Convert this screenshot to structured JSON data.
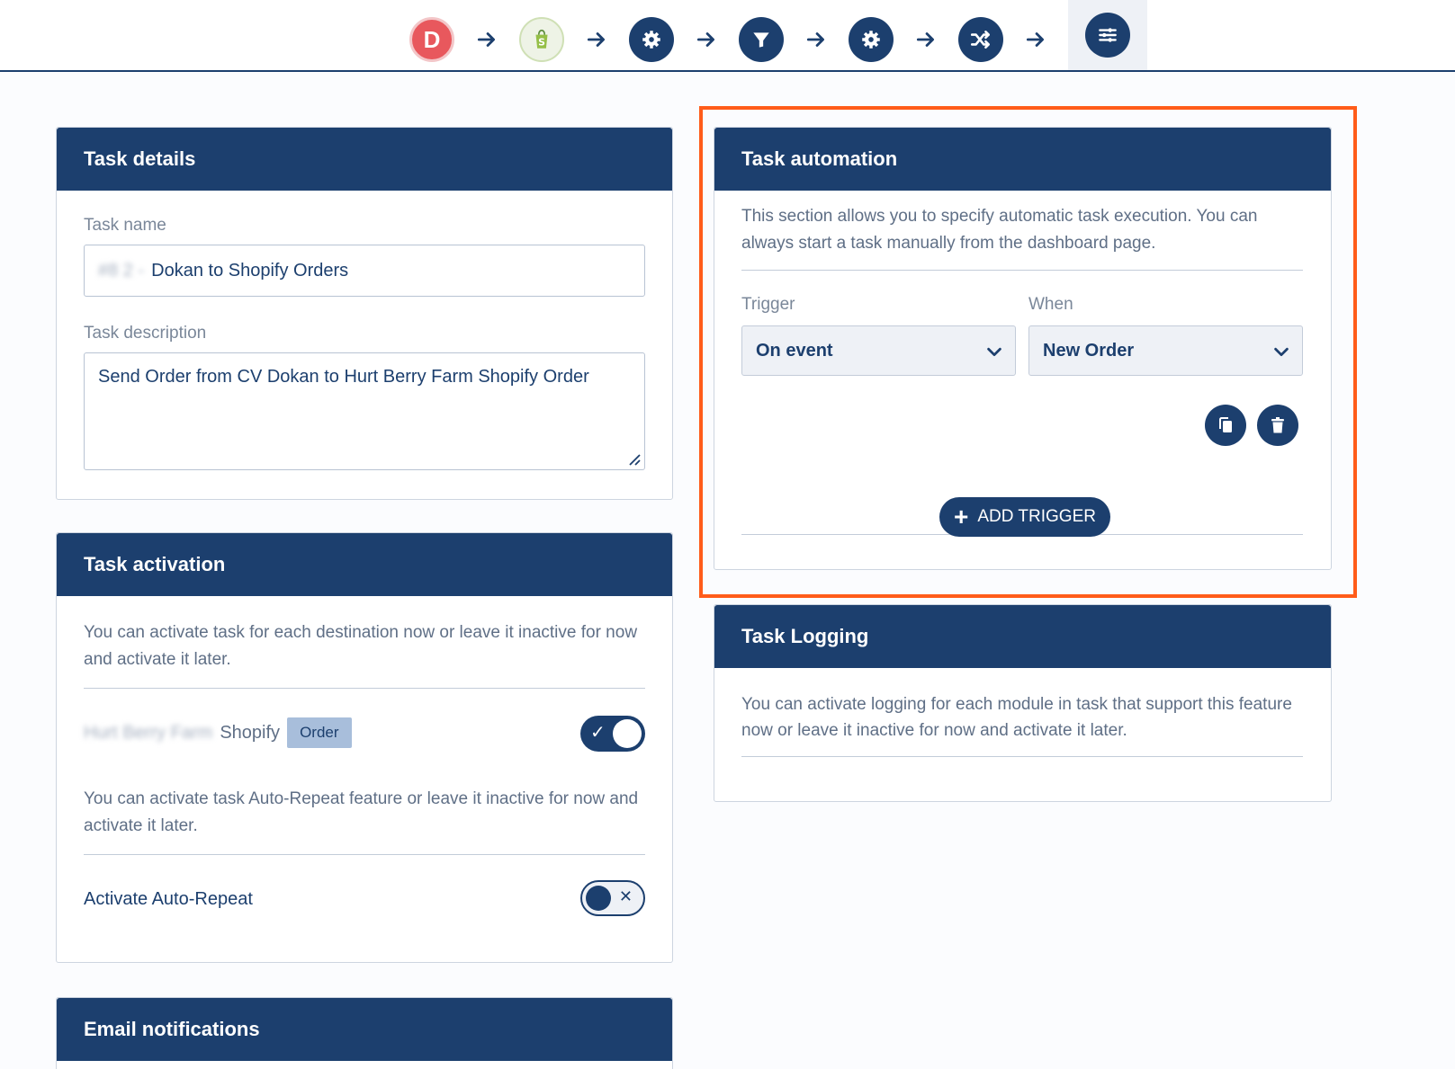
{
  "steps": [
    {
      "name": "dokan-logo-icon",
      "letter": "D",
      "color": "#e8585d"
    },
    {
      "name": "shopify-logo-icon",
      "letter": "S",
      "color": "#95bf47"
    },
    {
      "name": "gear-icon"
    },
    {
      "name": "filter-icon"
    },
    {
      "name": "gear-icon"
    },
    {
      "name": "shuffle-icon"
    },
    {
      "name": "sliders-icon"
    }
  ],
  "task_details": {
    "title": "Task details",
    "name_label": "Task name",
    "name_prefix_redacted": "#8 2 -",
    "name_value": "Dokan to Shopify Orders",
    "desc_label": "Task description",
    "desc_value": "Send Order from CV Dokan to Hurt Berry Farm Shopify Order"
  },
  "task_activation": {
    "title": "Task activation",
    "intro": "You can activate task for each destination now or leave it inactive for now and activate it later.",
    "destination_redacted": "Hurt Berry Farm",
    "destination_platform": "Shopify",
    "destination_badge": "Order",
    "destination_active": true,
    "autorepeat_intro": "You can activate task Auto-Repeat feature or leave it inactive for now and activate it later.",
    "autorepeat_label": "Activate Auto-Repeat",
    "autorepeat_active": false
  },
  "email_notifications": {
    "title": "Email notifications"
  },
  "task_automation": {
    "title": "Task automation",
    "intro": "This section allows you to specify automatic task execution. You can always start a task manually from the dashboard page.",
    "trigger_label": "Trigger",
    "trigger_value": "On event",
    "when_label": "When",
    "when_value": "New Order",
    "add_trigger_label": "ADD TRIGGER"
  },
  "task_logging": {
    "title": "Task Logging",
    "intro": "You can activate logging for each module in task that support this feature now or leave it inactive for now and activate it later."
  },
  "colors": {
    "brand": "#1c3f6e",
    "highlight": "#ff5c1a"
  }
}
